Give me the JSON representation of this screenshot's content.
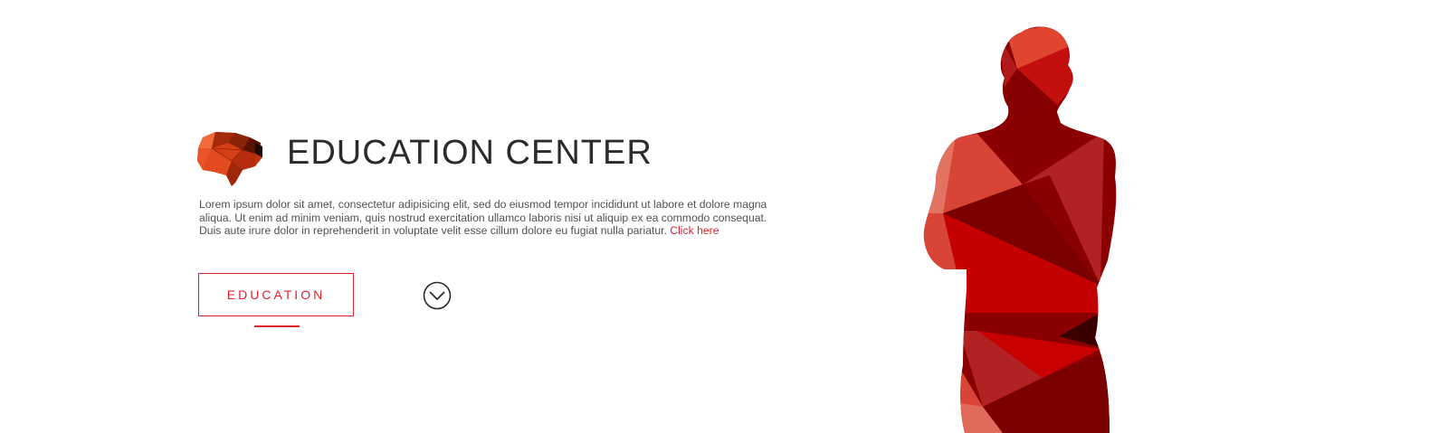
{
  "hero": {
    "title": "EDUCATION CENTER",
    "lead_text": "Lorem ipsum dolor sit amet, consectetur adipisicing elit, sed do eiusmod tempor incididunt ut labore et dolore magna aliqua. Ut enim ad minim veniam, quis nostrud exercitation ullamco laboris nisi ut aliquip ex ea commodo consequat. Duis aute irure dolor in reprehenderit in voluptate velit esse cillum dolore eu fugiat nulla pariatur.",
    "link_label": "Click here",
    "button_label": "EDUCATION",
    "icons": {
      "logo": "brain-icon",
      "scroll": "chevron-down-circle-icon",
      "figure": "person-silhouette"
    }
  },
  "colors": {
    "accent": "#e3202e",
    "title": "#2b2b2f",
    "body_text": "#505055"
  }
}
